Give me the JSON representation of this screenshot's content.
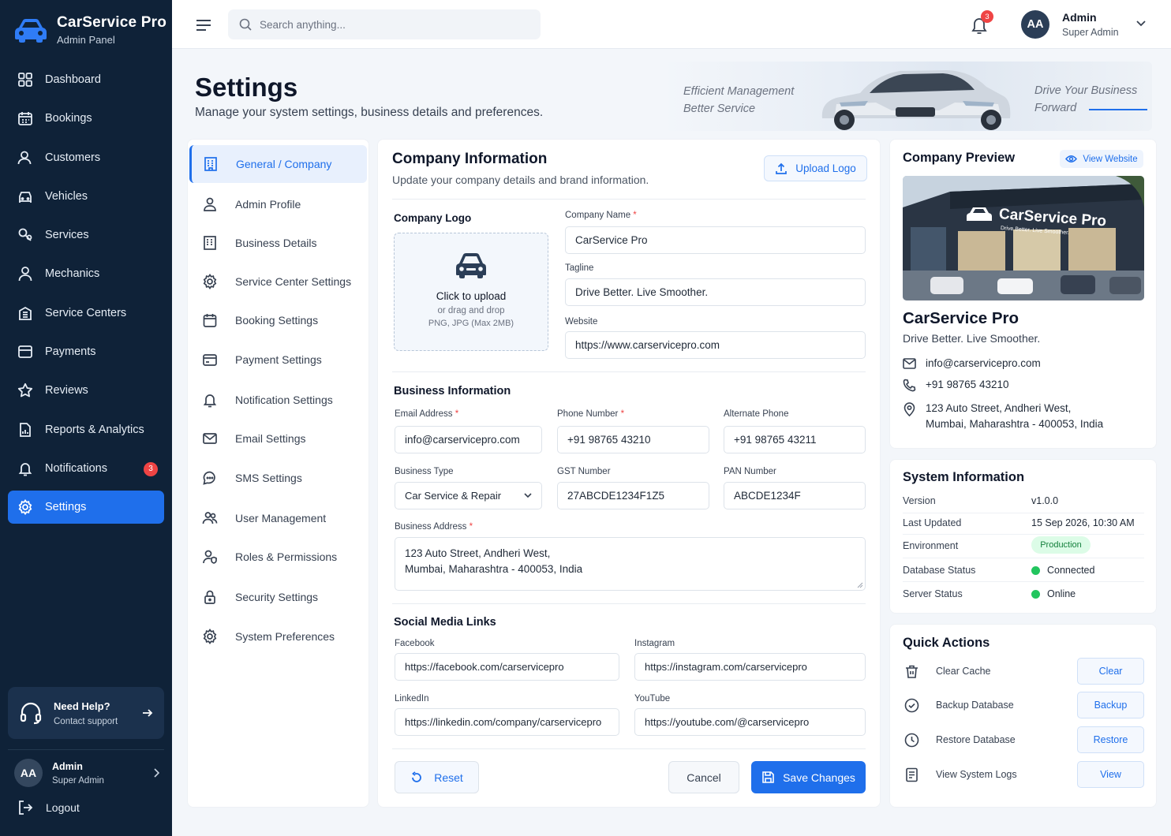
{
  "brand": {
    "name": "CarService Pro",
    "subtitle": "Admin Panel"
  },
  "sidebar": {
    "items": [
      {
        "label": "Dashboard",
        "icon": "dashboard-icon"
      },
      {
        "label": "Bookings",
        "icon": "calendar-icon"
      },
      {
        "label": "Customers",
        "icon": "users-icon"
      },
      {
        "label": "Vehicles",
        "icon": "car-icon"
      },
      {
        "label": "Services",
        "icon": "wrench-icon"
      },
      {
        "label": "Mechanics",
        "icon": "user-icon"
      },
      {
        "label": "Service Centers",
        "icon": "building-icon"
      },
      {
        "label": "Payments",
        "icon": "card-icon"
      },
      {
        "label": "Reviews",
        "icon": "star-icon"
      },
      {
        "label": "Reports & Analytics",
        "icon": "report-icon"
      },
      {
        "label": "Notifications",
        "icon": "bell-icon",
        "badge": "3"
      },
      {
        "label": "Settings",
        "icon": "gear-icon",
        "active": true
      }
    ],
    "help": {
      "title": "Need Help?",
      "subtitle": "Contact support"
    },
    "user": {
      "initials": "AA",
      "name": "Admin",
      "role": "Super Admin"
    },
    "logout": "Logout"
  },
  "topbar": {
    "search_placeholder": "Search anything...",
    "notification_count": "3",
    "user": {
      "initials": "AA",
      "name": "Admin",
      "role": "Super Admin"
    }
  },
  "header": {
    "title": "Settings",
    "subtitle": "Manage your system settings, business details and preferences.",
    "banner": {
      "line1": "Efficient Management",
      "line2": "Better Service",
      "line3": "Drive Your Business",
      "line4": "Forward"
    }
  },
  "settings_nav": [
    {
      "label": "General / Company",
      "active": true
    },
    {
      "label": "Admin Profile"
    },
    {
      "label": "Business Details"
    },
    {
      "label": "Service Center Settings"
    },
    {
      "label": "Booking Settings"
    },
    {
      "label": "Payment Settings"
    },
    {
      "label": "Notification Settings"
    },
    {
      "label": "Email Settings"
    },
    {
      "label": "SMS Settings"
    },
    {
      "label": "User Management"
    },
    {
      "label": "Roles & Permissions"
    },
    {
      "label": "Security Settings"
    },
    {
      "label": "System Preferences"
    }
  ],
  "company_info": {
    "title": "Company Information",
    "subtitle": "Update your company details and brand information.",
    "upload_logo": "Upload Logo",
    "logo": {
      "label": "Company Logo",
      "click": "Click to upload",
      "drag": "or drag and drop",
      "formats": "PNG, JPG (Max 2MB)"
    },
    "company_name": {
      "label": "Company Name",
      "value": "CarService Pro"
    },
    "tagline": {
      "label": "Tagline",
      "value": "Drive Better. Live Smoother."
    },
    "website": {
      "label": "Website",
      "value": "https://www.carservicepro.com"
    }
  },
  "business_info": {
    "title": "Business Information",
    "email": {
      "label": "Email Address",
      "value": "info@carservicepro.com"
    },
    "phone": {
      "label": "Phone Number",
      "value": "+91 98765 43210"
    },
    "alt_phone": {
      "label": "Alternate Phone",
      "value": "+91 98765 43211"
    },
    "type": {
      "label": "Business Type",
      "value": "Car Service & Repair"
    },
    "gst": {
      "label": "GST Number",
      "value": "27ABCDE1234F1Z5"
    },
    "pan": {
      "label": "PAN Number",
      "value": "ABCDE1234F"
    },
    "address": {
      "label": "Business Address",
      "line1": "123 Auto Street, Andheri West,",
      "line2": "Mumbai, Maharashtra - 400053, India"
    }
  },
  "social": {
    "title": "Social Media Links",
    "facebook": {
      "label": "Facebook",
      "value": "https://facebook.com/carservicepro"
    },
    "instagram": {
      "label": "Instagram",
      "value": "https://instagram.com/carservicepro"
    },
    "linkedin": {
      "label": "LinkedIn",
      "value": "https://linkedin.com/company/carservicepro"
    },
    "youtube": {
      "label": "YouTube",
      "value": "https://youtube.com/@carservicepro"
    }
  },
  "actions": {
    "reset": "Reset",
    "cancel": "Cancel",
    "save": "Save Changes"
  },
  "preview": {
    "title": "Company Preview",
    "view_website": "View Website",
    "sign_name": "CarService Pro",
    "sign_tag": "Drive Better. Live Smoother.",
    "name": "CarService Pro",
    "tagline": "Drive Better. Live Smoother.",
    "email": "info@carservicepro.com",
    "phone": "+91 98765 43210",
    "address_line1": "123 Auto Street, Andheri West,",
    "address_line2": "Mumbai, Maharashtra - 400053, India"
  },
  "system_info": {
    "title": "System Information",
    "rows": [
      {
        "key": "Version",
        "value": "v1.0.0"
      },
      {
        "key": "Last Updated",
        "value": "15 Sep 2026, 10:30 AM"
      },
      {
        "key": "Environment",
        "value": "Production"
      },
      {
        "key": "Database Status",
        "value": "Connected"
      },
      {
        "key": "Server Status",
        "value": "Online"
      }
    ],
    "status_color": "#22c55e"
  },
  "quick_actions": {
    "title": "Quick Actions",
    "items": [
      {
        "label": "Clear Cache",
        "button": "Clear"
      },
      {
        "label": "Backup Database",
        "button": "Backup"
      },
      {
        "label": "Restore Database",
        "button": "Restore"
      },
      {
        "label": "View System Logs",
        "button": "View"
      }
    ]
  },
  "colors": {
    "accent": "#1f6feb",
    "sidebar": "#0f2238",
    "danger": "#ef4444"
  }
}
